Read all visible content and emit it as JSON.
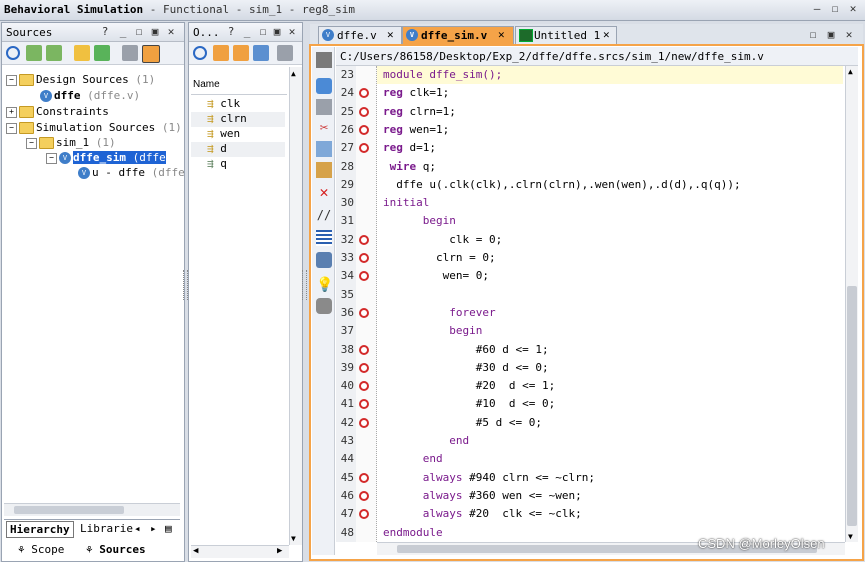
{
  "window": {
    "title_bold": "Behavioral Simulation",
    "title_rest": " - Functional - sim_1 - reg8_sim"
  },
  "sources_panel": {
    "header": "Sources",
    "tree": [
      {
        "label": "Design Sources",
        "count": "(1)"
      },
      {
        "label": "dffe",
        "sub": "(dffe.v)"
      },
      {
        "label": "Constraints"
      },
      {
        "label": "Simulation Sources",
        "count": "(1)"
      },
      {
        "label": "sim_1",
        "count": "(1)"
      },
      {
        "label": "dffe_sim",
        "sub": "(dffe"
      },
      {
        "label": "u - dffe",
        "sub": "(dffe"
      }
    ],
    "tabs": [
      "Hierarchy",
      "Librarie"
    ],
    "bottom_tabs": [
      "Scope",
      "Sources"
    ]
  },
  "objects_panel": {
    "header": "O...",
    "column": "Name",
    "items": [
      "clk",
      "clrn",
      "wen",
      "d",
      "q"
    ]
  },
  "editor": {
    "tabs": [
      {
        "label": "dffe.v"
      },
      {
        "label": "dffe_sim.v"
      },
      {
        "label": "Untitled 1"
      }
    ],
    "path": "C:/Users/86158/Desktop/Exp_2/dffe/dffe.srcs/sim_1/new/dffe_sim.v",
    "lines": [
      {
        "n": "23",
        "segs": [
          {
            "c": "kw2",
            "t": "module dffe_sim();"
          }
        ]
      },
      {
        "n": "24",
        "segs": [
          {
            "c": "kw",
            "t": "reg"
          },
          {
            "c": "normal",
            "t": " clk=1;"
          }
        ]
      },
      {
        "n": "25",
        "segs": [
          {
            "c": "kw",
            "t": "reg"
          },
          {
            "c": "normal",
            "t": " clrn=1;"
          }
        ]
      },
      {
        "n": "26",
        "segs": [
          {
            "c": "kw",
            "t": "reg"
          },
          {
            "c": "normal",
            "t": " wen=1;"
          }
        ]
      },
      {
        "n": "27",
        "segs": [
          {
            "c": "kw",
            "t": "reg"
          },
          {
            "c": "normal",
            "t": " d=1;"
          }
        ]
      },
      {
        "n": "28",
        "segs": [
          {
            "c": "kw",
            "t": " wire"
          },
          {
            "c": "normal",
            "t": " q;"
          }
        ]
      },
      {
        "n": "29",
        "segs": [
          {
            "c": "normal",
            "t": "  dffe u(.clk(clk),.clrn(clrn),.wen(wen),.d(d),.q(q));"
          }
        ]
      },
      {
        "n": "30",
        "segs": [
          {
            "c": "kw2",
            "t": "initial"
          }
        ]
      },
      {
        "n": "31",
        "segs": [
          {
            "c": "kw2",
            "t": "      begin"
          }
        ]
      },
      {
        "n": "32",
        "segs": [
          {
            "c": "normal",
            "t": "          clk = 0;"
          }
        ]
      },
      {
        "n": "33",
        "segs": [
          {
            "c": "normal",
            "t": "        clrn = 0;"
          }
        ]
      },
      {
        "n": "34",
        "segs": [
          {
            "c": "normal",
            "t": "         wen= 0;"
          }
        ]
      },
      {
        "n": "35",
        "segs": [
          {
            "c": "normal",
            "t": ""
          }
        ]
      },
      {
        "n": "36",
        "segs": [
          {
            "c": "kw2",
            "t": "          forever"
          }
        ]
      },
      {
        "n": "37",
        "segs": [
          {
            "c": "kw2",
            "t": "          begin"
          }
        ]
      },
      {
        "n": "38",
        "segs": [
          {
            "c": "normal",
            "t": "              #60 d <= 1;"
          }
        ]
      },
      {
        "n": "39",
        "segs": [
          {
            "c": "normal",
            "t": "              #30 d <= 0;"
          }
        ]
      },
      {
        "n": "40",
        "segs": [
          {
            "c": "normal",
            "t": "              #20  d <= 1;"
          }
        ]
      },
      {
        "n": "41",
        "segs": [
          {
            "c": "normal",
            "t": "              #10  d <= 0;"
          }
        ]
      },
      {
        "n": "42",
        "segs": [
          {
            "c": "normal",
            "t": "              #5 d <= 0;"
          }
        ]
      },
      {
        "n": "43",
        "segs": [
          {
            "c": "kw2",
            "t": "          end"
          }
        ]
      },
      {
        "n": "44",
        "segs": [
          {
            "c": "kw2",
            "t": "      end"
          }
        ]
      },
      {
        "n": "45",
        "segs": [
          {
            "c": "kw2",
            "t": "      always"
          },
          {
            "c": "normal",
            "t": " #940 clrn <= ~clrn;"
          }
        ]
      },
      {
        "n": "46",
        "segs": [
          {
            "c": "kw2",
            "t": "      always"
          },
          {
            "c": "normal",
            "t": " #360 wen <= ~wen;"
          }
        ]
      },
      {
        "n": "47",
        "segs": [
          {
            "c": "kw2",
            "t": "      always"
          },
          {
            "c": "normal",
            "t": " #20  clk <= ~clk;"
          }
        ]
      },
      {
        "n": "48",
        "segs": [
          {
            "c": "kw2",
            "t": "endmodule"
          }
        ]
      }
    ],
    "breakpoints": [
      "24",
      "25",
      "26",
      "27",
      "32",
      "33",
      "34",
      "36",
      "38",
      "39",
      "40",
      "41",
      "42",
      "45",
      "46",
      "47"
    ]
  },
  "watermark": "CSDN @MorleyOlsen"
}
